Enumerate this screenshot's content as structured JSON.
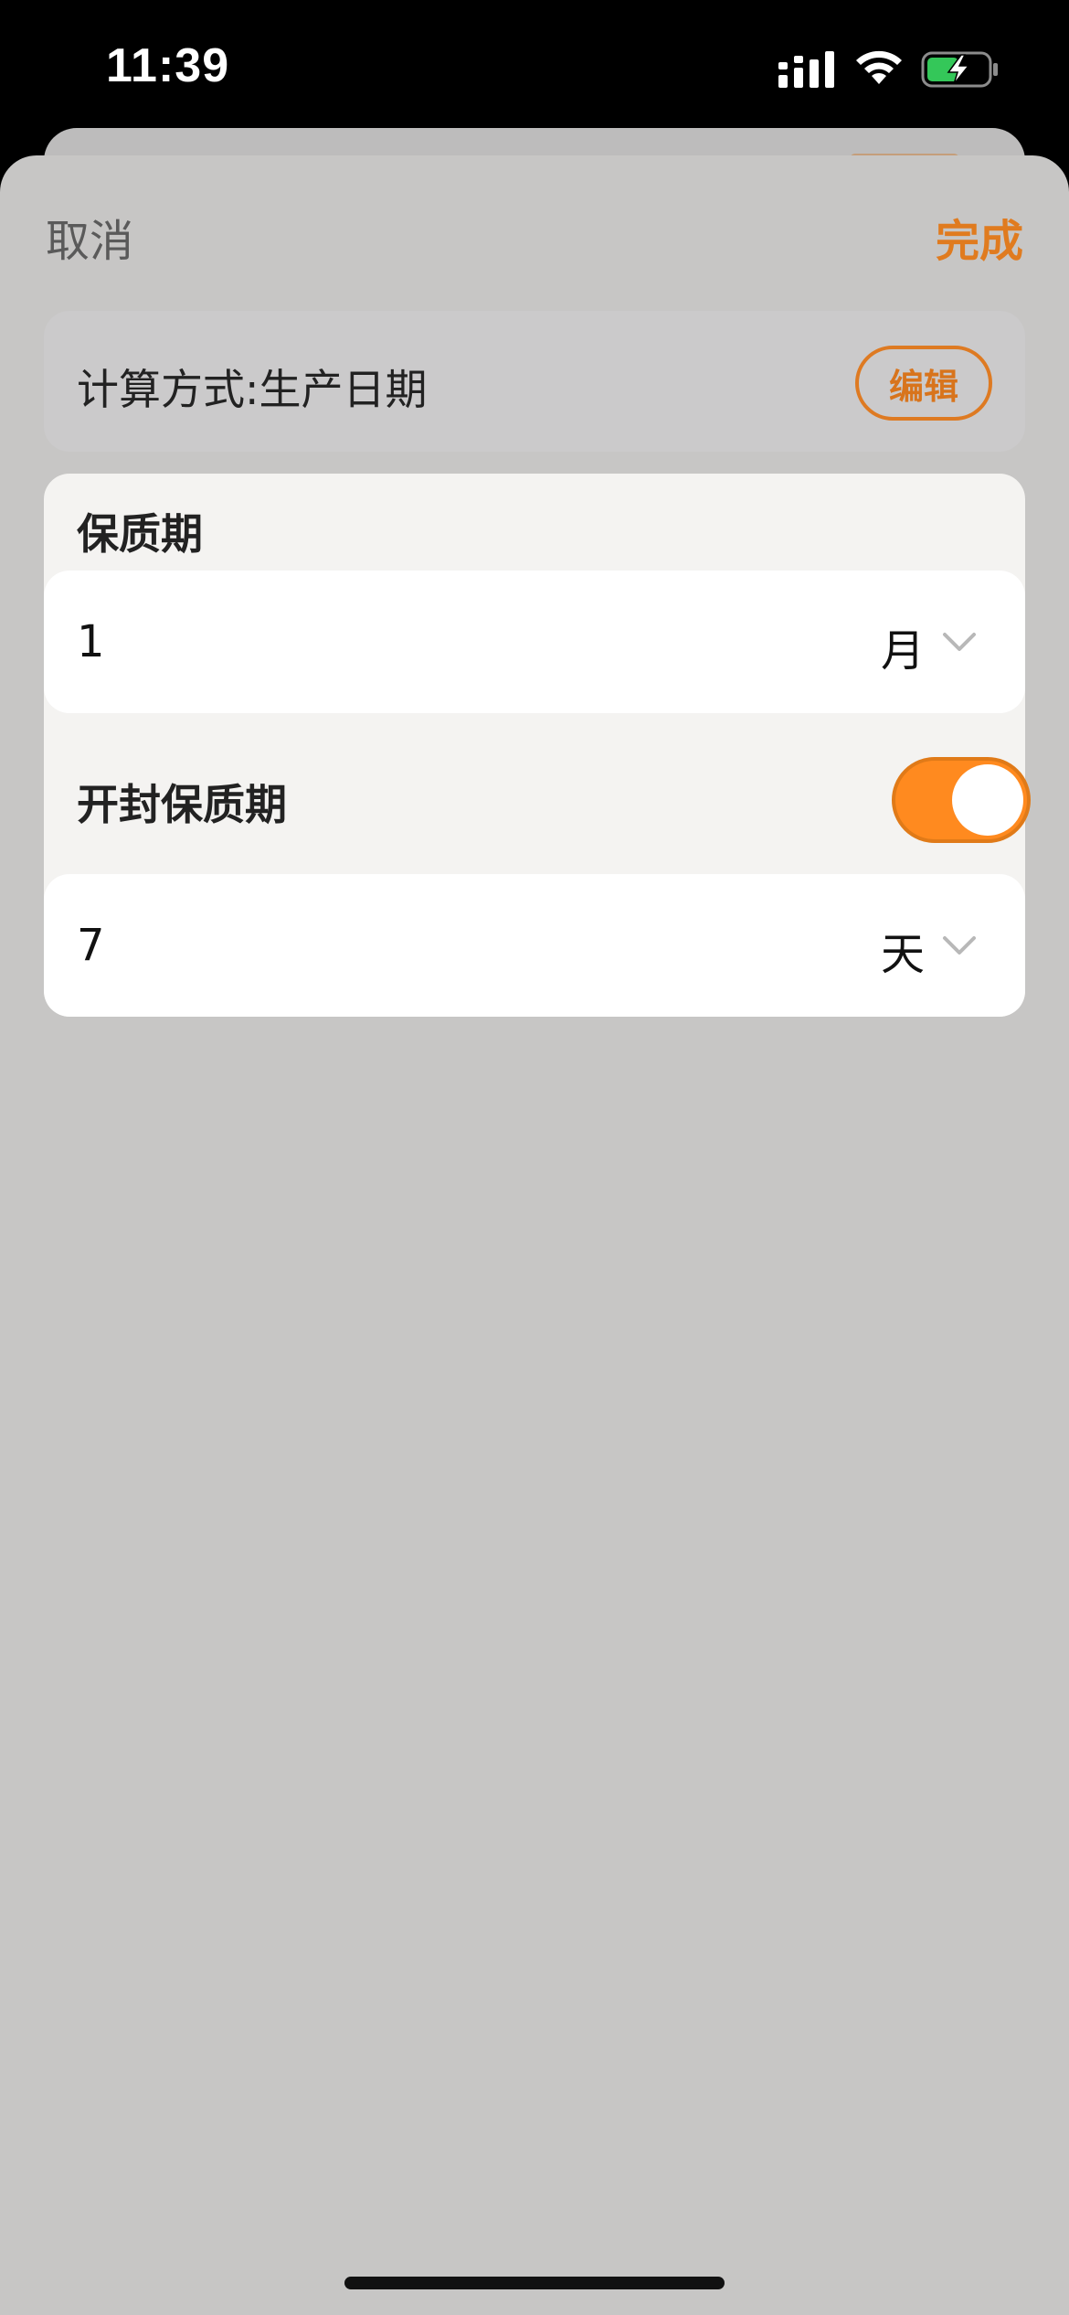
{
  "status_bar": {
    "time": "11:39"
  },
  "nav": {
    "cancel_label": "取消",
    "done_label": "完成"
  },
  "calc": {
    "label": "计算方式:生产日期",
    "edit_label": "编辑"
  },
  "shelf_life": {
    "title": "保质期",
    "value": "1",
    "unit": "月"
  },
  "opened_shelf_life": {
    "title": "开封保质期",
    "enabled": true,
    "value": "7",
    "unit": "天"
  },
  "colors": {
    "accent": "#ff8a1f",
    "accent_text": "#e07b1f",
    "sheet_bg": "#c7c6c5"
  },
  "icons": {
    "signal": "signal-bars-icon",
    "wifi": "wifi-icon",
    "battery": "battery-charging-icon",
    "chevron": "chevron-down-icon"
  }
}
